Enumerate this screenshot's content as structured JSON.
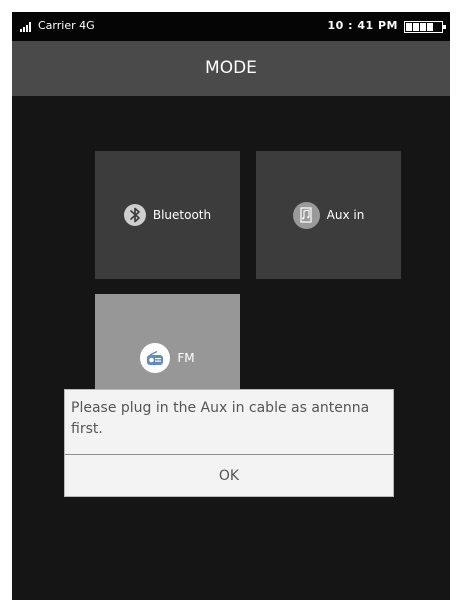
{
  "status_bar": {
    "carrier": "Carrier  4G",
    "time": "10 : 41 PM"
  },
  "header": {
    "title": "MODE"
  },
  "modes": [
    {
      "label": "Bluetooth",
      "icon": "bluetooth-icon",
      "selected": false
    },
    {
      "label": "Aux in",
      "icon": "music-file-icon",
      "selected": false
    },
    {
      "label": "FM",
      "icon": "radio-icon",
      "selected": true
    }
  ],
  "dialog": {
    "message": "Please plug in the Aux in cable as antenna first.",
    "ok_label": "OK"
  },
  "colors": {
    "background": "#151515",
    "header": "#4a4a4a",
    "tile": "#3c3c3c",
    "tile_selected": "#979797",
    "dialog": "#f3f3f3"
  }
}
